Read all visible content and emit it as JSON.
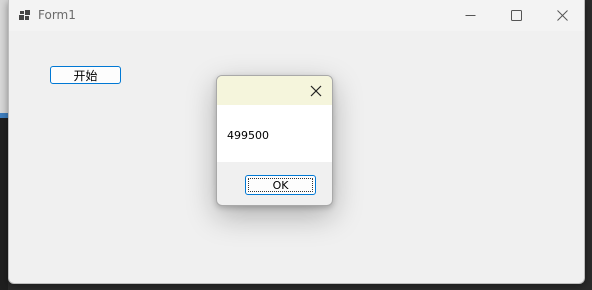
{
  "window": {
    "title": "Form1",
    "controls": {
      "minimize_icon": "minimize-icon",
      "maximize_icon": "maximize-icon",
      "close_icon": "close-icon"
    }
  },
  "form": {
    "start_button_label": "开始"
  },
  "dialog": {
    "message": "499500",
    "ok_label": "OK",
    "close_icon": "close-icon"
  },
  "colors": {
    "accent": "#0078d4",
    "dialog_title_bg": "#f5f5dc",
    "form_bg": "#f0f0f0"
  }
}
